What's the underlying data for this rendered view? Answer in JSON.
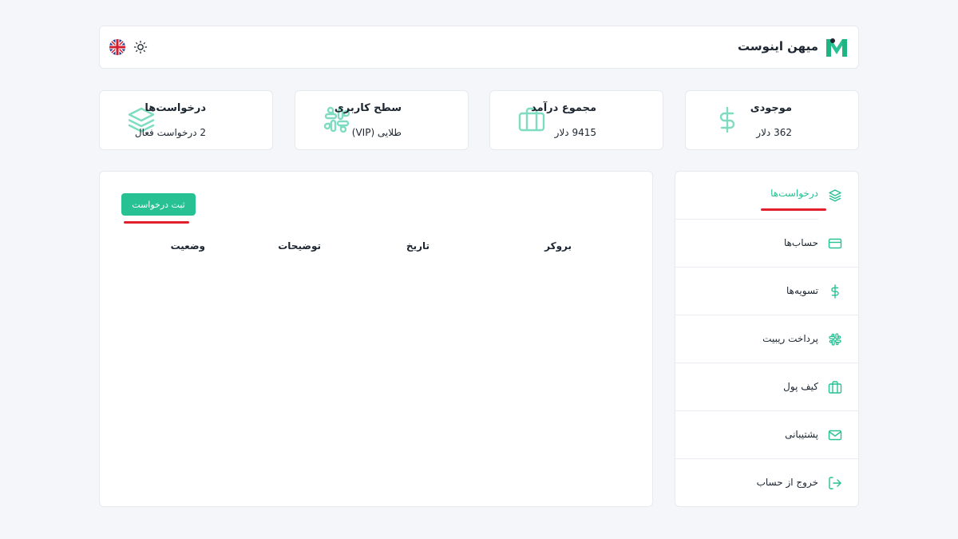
{
  "header": {
    "brand": "میهن اینوست",
    "language_icon": "uk-flag-icon",
    "theme_icon": "sun-icon"
  },
  "stats": [
    {
      "title": "موجودی",
      "value": "362 دلار",
      "icon": "dollar-icon"
    },
    {
      "title": "مجموع درآمد",
      "value": "9415 دلار",
      "icon": "briefcase-icon"
    },
    {
      "title": "سطح کاربری",
      "value": "طلایی (VIP)",
      "icon": "slack-icon"
    },
    {
      "title": "درخواست‌ها",
      "value": "2 درخواست فعال",
      "icon": "layers-icon"
    }
  ],
  "main": {
    "submit_label": "ثبت درخواست",
    "columns": [
      "بروکر",
      "تاریخ",
      "توضیحات",
      "وضعیت"
    ],
    "rows": []
  },
  "sidebar": {
    "items": [
      {
        "label": "درخواست‌ها",
        "icon": "layers-icon",
        "active": true
      },
      {
        "label": "حساب‌ها",
        "icon": "credit-card-icon",
        "active": false
      },
      {
        "label": "تسویه‌ها",
        "icon": "dollar-icon",
        "active": false
      },
      {
        "label": "پرداخت ریبیت",
        "icon": "slack-icon",
        "active": false
      },
      {
        "label": "کیف پول",
        "icon": "briefcase-icon",
        "active": false
      },
      {
        "label": "پشتیبانی",
        "icon": "mail-icon",
        "active": false
      },
      {
        "label": "خروج از حساب",
        "icon": "logout-icon",
        "active": false
      }
    ]
  },
  "colors": {
    "accent": "#27c193",
    "underline": "#e0202d",
    "background": "#f4f6f9",
    "text": "#1c2530"
  }
}
